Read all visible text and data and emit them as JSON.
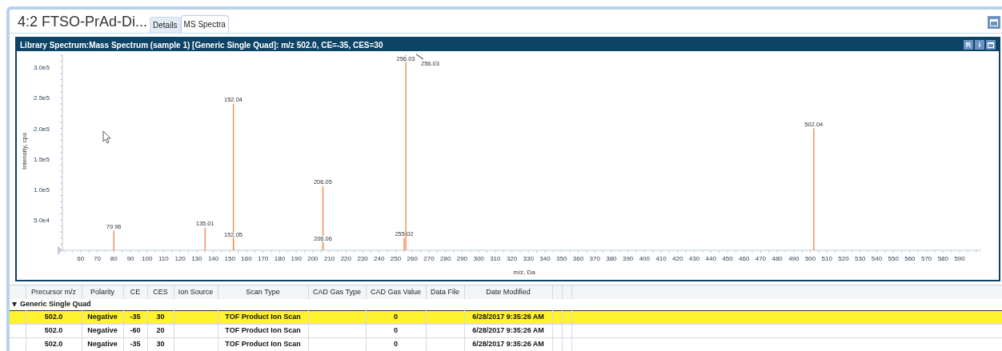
{
  "window": {
    "title": "4:2 FTSO-PrAd-Di..."
  },
  "tabs": [
    {
      "label": "Details",
      "selected": false
    },
    {
      "label": "MS Spectra",
      "selected": true
    }
  ],
  "spectrum_panel": {
    "title": "Library Spectrum:Mass Spectrum (sample 1) [Generic Single Quad]: m/z 502.0, CE=-35, CES=30",
    "buttons": [
      "R",
      "i"
    ],
    "chart_data": {
      "type": "bar",
      "xlabel": "m/z, Da",
      "ylabel": "Intensity, cps",
      "xlim": [
        49,
        603
      ],
      "ylim": [
        0,
        320000
      ],
      "xticks": [
        60,
        70,
        80,
        90,
        100,
        110,
        120,
        130,
        140,
        150,
        160,
        170,
        180,
        190,
        200,
        210,
        220,
        230,
        240,
        250,
        260,
        270,
        280,
        290,
        300,
        310,
        320,
        330,
        340,
        350,
        360,
        370,
        380,
        390,
        400,
        410,
        420,
        430,
        440,
        450,
        460,
        470,
        480,
        490,
        500,
        510,
        520,
        530,
        540,
        550,
        560,
        570,
        580,
        590
      ],
      "yticks": [
        {
          "value": 50000,
          "label": "5.0e4"
        },
        {
          "value": 100000,
          "label": "1.0e5"
        },
        {
          "value": 150000,
          "label": "1.5e5"
        },
        {
          "value": 200000,
          "label": "2.0e5"
        },
        {
          "value": 250000,
          "label": "2.5e5"
        },
        {
          "value": 300000,
          "label": "3.0e5"
        }
      ],
      "x": [
        79.96,
        135.01,
        152.04,
        152.05,
        206.05,
        206.06,
        255.02,
        256.03,
        502.04
      ],
      "series": [
        {
          "color": "#f28c4e",
          "values": [
            32000,
            37000,
            240000,
            18000,
            105000,
            12000,
            20000,
            320000,
            200000
          ]
        }
      ],
      "value_labels": [
        "79.96",
        "135.01",
        "152.04",
        "152.05",
        "206.05",
        "206.06",
        "255.02",
        "256.03",
        "502.04"
      ],
      "annotations": [
        {
          "text": "256.03",
          "x": 256.03,
          "y": 320000
        }
      ]
    }
  },
  "table": {
    "columns": [
      "Precursor m/z",
      "Polarity",
      "CE",
      "CES",
      "Ion Source",
      "Scan Type",
      "CAD Gas Type",
      "CAD Gas Value",
      "Data File",
      "Date Modified"
    ],
    "group": {
      "label": "Generic Single Quad",
      "expanded": true
    },
    "rows": [
      {
        "selected": true,
        "cells": [
          "502.0",
          "Negative",
          "-35",
          "30",
          "",
          "TOF Product Ion Scan",
          "",
          "0",
          "",
          "6/28/2017 9:35:26 AM"
        ]
      },
      {
        "selected": false,
        "cells": [
          "502.0",
          "Negative",
          "-60",
          "20",
          "",
          "TOF Product Ion Scan",
          "",
          "0",
          "",
          "6/28/2017 9:35:26 AM"
        ]
      },
      {
        "selected": false,
        "cells": [
          "502.0",
          "Negative",
          "-35",
          "30",
          "",
          "TOF Product Ion Scan",
          "",
          "0",
          "",
          "6/28/2017 9:35:26 AM"
        ]
      }
    ]
  }
}
